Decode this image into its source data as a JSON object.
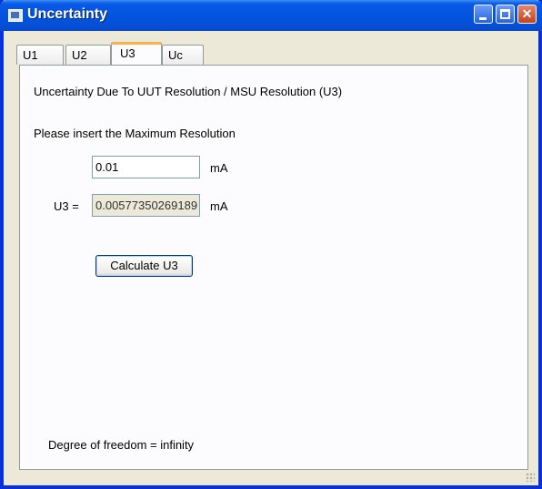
{
  "window": {
    "title": "Uncertainty",
    "controls": {
      "minimize": "minimize",
      "maximize": "maximize",
      "close": "✕"
    }
  },
  "tabs": [
    {
      "label": "U1",
      "active": false
    },
    {
      "label": "U2",
      "active": false
    },
    {
      "label": "U3",
      "active": true
    },
    {
      "label": "Uc",
      "active": false
    }
  ],
  "panel": {
    "heading": "Uncertainty Due To UUT Resolution / MSU Resolution (U3)",
    "instruction": "Please insert the Maximum Resolution",
    "resolution_input": {
      "value": "0.01",
      "unit": "mA"
    },
    "result": {
      "label": "U3 =",
      "value": "0.00577350269189",
      "unit": "mA"
    },
    "calculate_button": "Calculate U3",
    "degree_of_freedom": "Degree of freedom = infinity"
  },
  "colors": {
    "titlebar": "#0454e0",
    "window_bg": "#ece9d8",
    "panel_bg": "#fcfcfe",
    "active_tab_accent": "#f7b24a"
  }
}
